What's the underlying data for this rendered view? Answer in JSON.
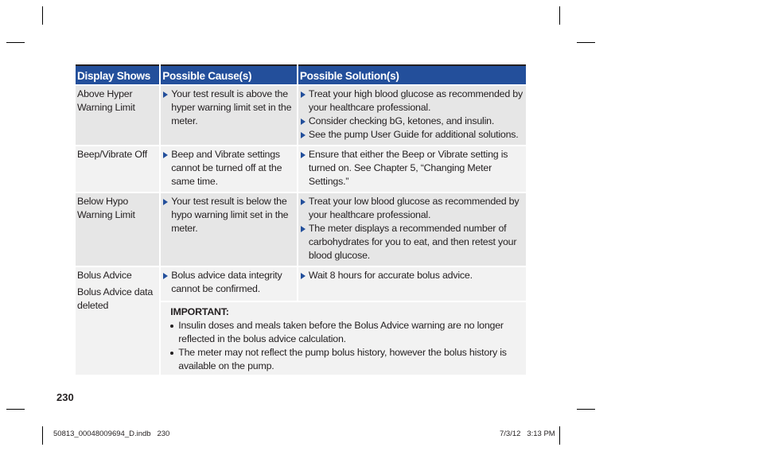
{
  "table": {
    "headers": [
      "Display Shows",
      "Possible Cause(s)",
      "Possible Solution(s)"
    ],
    "rows": [
      {
        "display": [
          "Above Hyper Warning Limit"
        ],
        "causes": [
          "Your test result is above the hyper warning limit set in the meter."
        ],
        "solutions": [
          "Treat your high blood glucose as recommended by your healthcare professional.",
          "Consider checking bG, ketones, and insulin.",
          "See the pump User Guide for additional solutions."
        ]
      },
      {
        "display": [
          "Beep/Vibrate Off"
        ],
        "causes": [
          "Beep and Vibrate settings cannot be turned off at the same time."
        ],
        "solutions": [
          "Ensure that either the Beep or Vibrate setting is turned on. See Chapter 5, “Changing Meter Settings.”"
        ]
      },
      {
        "display": [
          "Below Hypo Warning Limit"
        ],
        "causes": [
          "Your test result is below the hypo warning limit set in the meter."
        ],
        "solutions": [
          "Treat your low blood glucose as recommended by your healthcare professional.",
          "The meter displays a recommended number of carbohydrates for you to eat, and then retest your blood glucose."
        ]
      },
      {
        "display": [
          "Bolus Advice",
          "Bolus Advice data deleted"
        ],
        "causes": [
          "Bolus advice data integrity cannot be confirmed."
        ],
        "solutions": [
          "Wait 8 hours for accurate bolus advice."
        ],
        "important": {
          "title": "IMPORTANT:",
          "items": [
            "Insulin doses and meals taken before the Bolus Advice warning are no longer reflected in the bolus advice calculation.",
            "The meter may not reflect the pump bolus history, however the bolus history is available on the pump."
          ]
        }
      }
    ]
  },
  "footer": {
    "page_number": "230",
    "slug_file": "50813_00048009694_D.indb   230",
    "slug_datetime": "7/3/12   3:13 PM"
  },
  "colors": {
    "header_blue": "#234f9b",
    "row_dark": "#e6e6e6",
    "row_light": "#f2f2f2",
    "bullet": "#234f9b"
  }
}
